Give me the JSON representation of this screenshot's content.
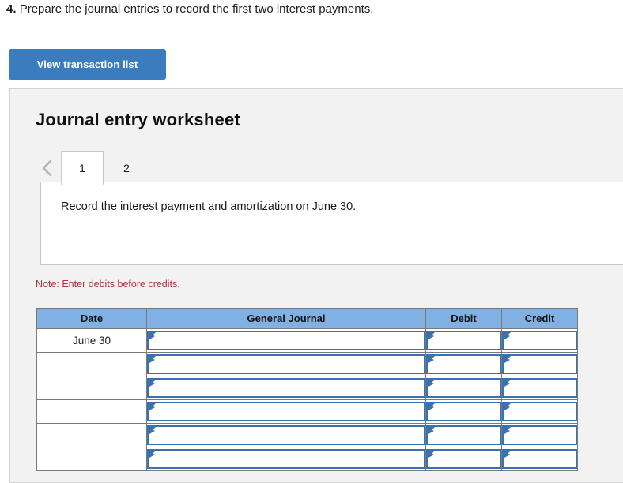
{
  "question": {
    "number": "4.",
    "text": "Prepare the journal entries to record the first two interest payments."
  },
  "toolbar": {
    "transaction_list_label": "View transaction list"
  },
  "worksheet": {
    "title": "Journal entry worksheet",
    "tabs": [
      {
        "label": "1",
        "active": true
      },
      {
        "label": "2",
        "active": false
      }
    ],
    "prev_icon": "chevron-left-icon",
    "instruction": "Record the interest payment and amortization on June 30.",
    "note": "Note: Enter debits before credits."
  },
  "table": {
    "headers": [
      "Date",
      "General Journal",
      "Debit",
      "Credit"
    ],
    "rows": [
      {
        "date": "June 30",
        "journal": "",
        "debit": "",
        "credit": ""
      },
      {
        "date": "",
        "journal": "",
        "debit": "",
        "credit": ""
      },
      {
        "date": "",
        "journal": "",
        "debit": "",
        "credit": ""
      },
      {
        "date": "",
        "journal": "",
        "debit": "",
        "credit": ""
      },
      {
        "date": "",
        "journal": "",
        "debit": "",
        "credit": ""
      },
      {
        "date": "",
        "journal": "",
        "debit": "",
        "credit": ""
      }
    ]
  },
  "colors": {
    "button_blue": "#3a7cbe",
    "header_blue": "#81b1e3",
    "field_border_blue": "#3a72b0",
    "note_red": "#a8343c",
    "panel_gray": "#f2f2f2"
  }
}
